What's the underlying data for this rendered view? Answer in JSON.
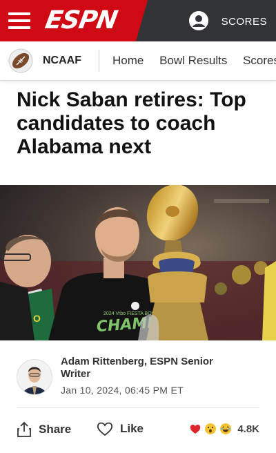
{
  "header": {
    "brand": "ESPN",
    "scores_label": "SCORES"
  },
  "subnav": {
    "league": "NCAAF",
    "links": [
      "Home",
      "Bowl Results",
      "Scores"
    ]
  },
  "article": {
    "headline": "Nick Saban retires: Top candidates to coach Alabama next",
    "hero_image": {
      "shirt_small_text": "2024 Vrbo FIESTA BOWL",
      "shirt_big_text": "CHAMPS"
    },
    "byline": {
      "author": "Adam Rittenberg, ESPN Senior Writer",
      "date": "Jan 10, 2024, 06:45 PM ET"
    },
    "actions": {
      "share_label": "Share",
      "like_label": "Like",
      "reaction_count": "4.8K",
      "reactions": [
        "heart-emoji",
        "wow-emoji",
        "laugh-emoji"
      ]
    }
  },
  "colors": {
    "espn_red": "#d00a14",
    "header_gray": "#333437"
  }
}
